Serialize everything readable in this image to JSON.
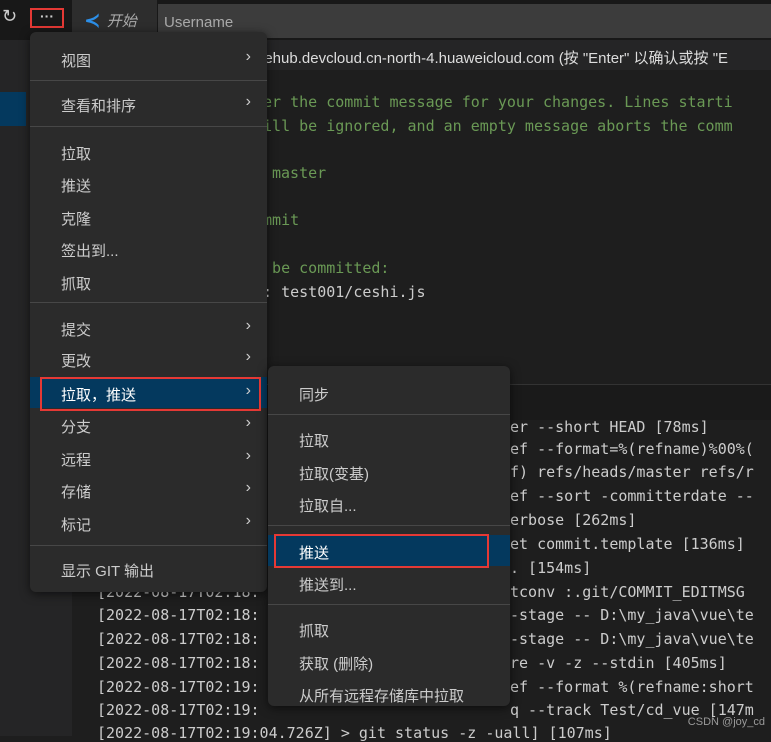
{
  "colors": {
    "accent": "#04395e",
    "highlight_box": "#e53935",
    "comment": "#6a9955"
  },
  "topbar": {
    "refresh_icon": "refresh-icon",
    "more_label": "···",
    "tab_title": "开始",
    "input_placeholder": "Username",
    "prompt": "dehub.devcloud.cn-north-4.huaweicloud.com (按 \"Enter\" 以确认或按 \"E"
  },
  "editor": {
    "lines": [
      "ter the commit message for your changes. Lines starti",
      "will be ignored, and an empty message aborts the comm",
      "master",
      "ommit",
      "o be committed:",
      "e:   test001/ceshi.js"
    ]
  },
  "output": {
    "left": [
      "[2022-08-17T02:18:",
      "[2022-08-17T02:18:",
      "[2022-08-17T02:18:",
      "[2022-08-17T02:18:",
      "[2022-08-17T02:19:",
      "[2022-08-17T02:19:",
      "[2022-08-17T02:19:04.726Z] > git status -z -uall] [107ms]"
    ],
    "right": [
      "er --short HEAD [78ms]",
      "ef --format=%(refname)%00%(",
      "f) refs/heads/master refs/r",
      "ef --sort -committerdate --",
      "erbose [262ms]",
      "et commit.template [136ms]",
      ". [154ms]",
      "tconv :.git/COMMIT_EDITMSG",
      "-stage -- D:\\my_java\\vue\\te",
      "-stage -- D:\\my_java\\vue\\te",
      "re -v -z --stdin [405ms]",
      "ef --format %(refname:short",
      "q --track Test/cd_vue [147m"
    ]
  },
  "menu": {
    "items": [
      "视图",
      "查看和排序",
      "拉取",
      "推送",
      "克隆",
      "签出到...",
      "抓取",
      "提交",
      "更改",
      "拉取，推送",
      "分支",
      "远程",
      "存储",
      "标记",
      "显示 GIT 输出"
    ]
  },
  "submenu": {
    "items": [
      "同步",
      "拉取",
      "拉取(变基)",
      "拉取自...",
      "推送",
      "推送到...",
      "抓取",
      "获取 (删除)",
      "从所有远程存储库中拉取"
    ]
  },
  "watermark": "CSDN @joy_cd"
}
